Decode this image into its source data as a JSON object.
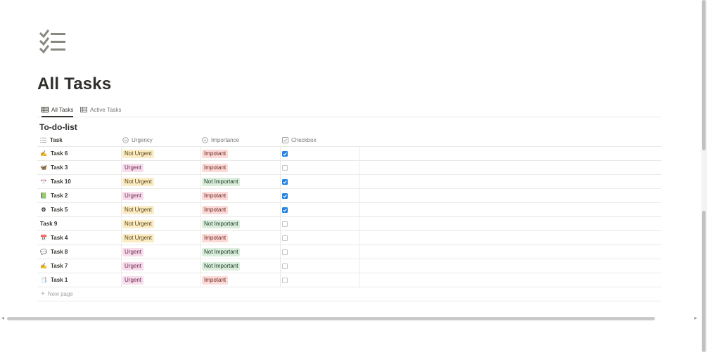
{
  "page": {
    "icon": "checklist-icon",
    "title": "All Tasks"
  },
  "views": [
    {
      "label": "All Tasks",
      "icon": "table-icon",
      "active": true
    },
    {
      "label": "Active Tasks",
      "icon": "table-icon",
      "active": false
    }
  ],
  "database": {
    "title": "To-do-list",
    "columns": {
      "task": "Task",
      "urgency": "Urgency",
      "importance": "Importance",
      "checkbox": "Checkbox"
    },
    "rows": [
      {
        "icon": "pencil-icon",
        "emoji": "✍",
        "task": "Task 6",
        "urgency": "Not Urgent",
        "importance": "Impotant",
        "checked": true
      },
      {
        "icon": "butterfly-icon",
        "emoji": "🦋",
        "task": "Task 3",
        "urgency": "Urgent",
        "importance": "Impotant",
        "checked": false
      },
      {
        "icon": "flag-icon",
        "emoji": "🎌",
        "task": "Task 10",
        "urgency": "Not Urgent",
        "importance": "Not Important",
        "checked": true
      },
      {
        "icon": "book-icon",
        "emoji": "📗",
        "task": "Task 2",
        "urgency": "Urgent",
        "importance": "Impotant",
        "checked": true
      },
      {
        "icon": "gear-icon",
        "emoji": "⚙",
        "task": "Task 5",
        "urgency": "Not Urgent",
        "importance": "Impotant",
        "checked": true
      },
      {
        "icon": "",
        "emoji": "",
        "task": "Task 9",
        "urgency": "Not Urgent",
        "importance": "Not Important",
        "checked": false
      },
      {
        "icon": "calendar-icon",
        "emoji": "📅",
        "task": "Task 4",
        "urgency": "Not Urgent",
        "importance": "Impotant",
        "checked": false
      },
      {
        "icon": "speech-bubble-icon",
        "emoji": "💬",
        "task": "Task 8",
        "urgency": "Urgent",
        "importance": "Not Important",
        "checked": false
      },
      {
        "icon": "pencil-icon",
        "emoji": "✍",
        "task": "Task 7",
        "urgency": "Urgent",
        "importance": "Not Important",
        "checked": false
      },
      {
        "icon": "bookmark-tabs-icon",
        "emoji": "📑",
        "task": "Task 1",
        "urgency": "Urgent",
        "importance": "Impotant",
        "checked": false
      }
    ],
    "new_page_label": "New page"
  },
  "colors": {
    "not_urgent": "#fbecc6",
    "urgent": "#f7dcec",
    "impotant": "#fbdad7",
    "not_important": "#dbeddb",
    "checkbox_on": "#2383e2"
  }
}
